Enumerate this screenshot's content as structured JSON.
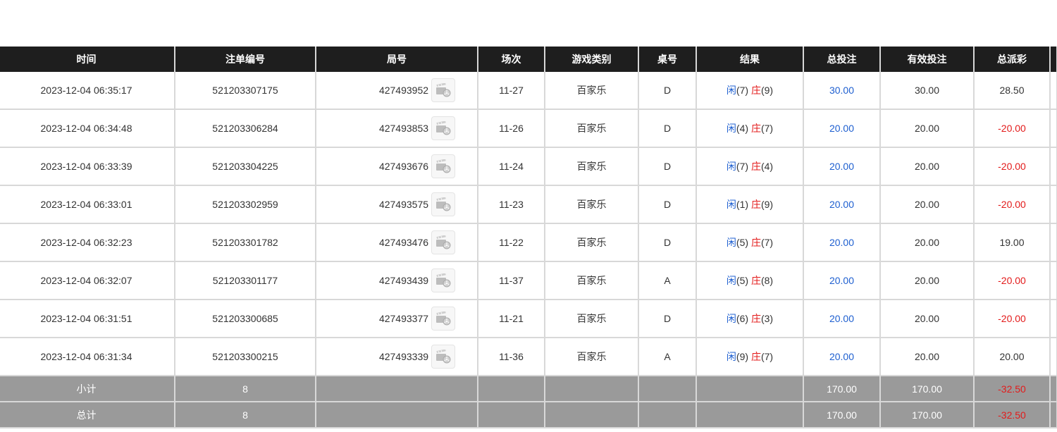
{
  "headers": [
    "时间",
    "注单编号",
    "局号",
    "场次",
    "游戏类别",
    "桌号",
    "结果",
    "总投注",
    "有效投注",
    "总派彩"
  ],
  "rows": [
    {
      "time": "2023-12-04 06:35:17",
      "bet_id": "521203307175",
      "round": "427493952",
      "session": "11-27",
      "game": "百家乐",
      "table": "D",
      "player_label": "闲",
      "player_score": "(7)",
      "banker_label": "庄",
      "banker_score": "(9)",
      "total_bet": "30.00",
      "valid_bet": "30.00",
      "payout": "28.50",
      "payout_negative": false
    },
    {
      "time": "2023-12-04 06:34:48",
      "bet_id": "521203306284",
      "round": "427493853",
      "session": "11-26",
      "game": "百家乐",
      "table": "D",
      "player_label": "闲",
      "player_score": "(4)",
      "banker_label": "庄",
      "banker_score": "(7)",
      "total_bet": "20.00",
      "valid_bet": "20.00",
      "payout": "-20.00",
      "payout_negative": true
    },
    {
      "time": "2023-12-04 06:33:39",
      "bet_id": "521203304225",
      "round": "427493676",
      "session": "11-24",
      "game": "百家乐",
      "table": "D",
      "player_label": "闲",
      "player_score": "(7)",
      "banker_label": "庄",
      "banker_score": "(4)",
      "total_bet": "20.00",
      "valid_bet": "20.00",
      "payout": "-20.00",
      "payout_negative": true
    },
    {
      "time": "2023-12-04 06:33:01",
      "bet_id": "521203302959",
      "round": "427493575",
      "session": "11-23",
      "game": "百家乐",
      "table": "D",
      "player_label": "闲",
      "player_score": "(1)",
      "banker_label": "庄",
      "banker_score": "(9)",
      "total_bet": "20.00",
      "valid_bet": "20.00",
      "payout": "-20.00",
      "payout_negative": true
    },
    {
      "time": "2023-12-04 06:32:23",
      "bet_id": "521203301782",
      "round": "427493476",
      "session": "11-22",
      "game": "百家乐",
      "table": "D",
      "player_label": "闲",
      "player_score": "(5)",
      "banker_label": "庄",
      "banker_score": "(7)",
      "total_bet": "20.00",
      "valid_bet": "20.00",
      "payout": "19.00",
      "payout_negative": false
    },
    {
      "time": "2023-12-04 06:32:07",
      "bet_id": "521203301177",
      "round": "427493439",
      "session": "11-37",
      "game": "百家乐",
      "table": "A",
      "player_label": "闲",
      "player_score": "(5)",
      "banker_label": "庄",
      "banker_score": "(8)",
      "total_bet": "20.00",
      "valid_bet": "20.00",
      "payout": "-20.00",
      "payout_negative": true
    },
    {
      "time": "2023-12-04 06:31:51",
      "bet_id": "521203300685",
      "round": "427493377",
      "session": "11-21",
      "game": "百家乐",
      "table": "D",
      "player_label": "闲",
      "player_score": "(6)",
      "banker_label": "庄",
      "banker_score": "(3)",
      "total_bet": "20.00",
      "valid_bet": "20.00",
      "payout": "-20.00",
      "payout_negative": true
    },
    {
      "time": "2023-12-04 06:31:34",
      "bet_id": "521203300215",
      "round": "427493339",
      "session": "11-36",
      "game": "百家乐",
      "table": "A",
      "player_label": "闲",
      "player_score": "(9)",
      "banker_label": "庄",
      "banker_score": "(7)",
      "total_bet": "20.00",
      "valid_bet": "20.00",
      "payout": "20.00",
      "payout_negative": false
    }
  ],
  "subtotal": {
    "label": "小计",
    "count": "8",
    "total_bet": "170.00",
    "valid_bet": "170.00",
    "payout": "-32.50"
  },
  "grand_total": {
    "label": "总计",
    "count": "8",
    "total_bet": "170.00",
    "valid_bet": "170.00",
    "payout": "-32.50"
  },
  "icons": {
    "replay": "video-replay-icon"
  },
  "colors": {
    "header_bg": "#1e1e1e",
    "total_bg": "#9a9a9a",
    "blue": "#1e5fd0",
    "red": "#e31b1b"
  }
}
